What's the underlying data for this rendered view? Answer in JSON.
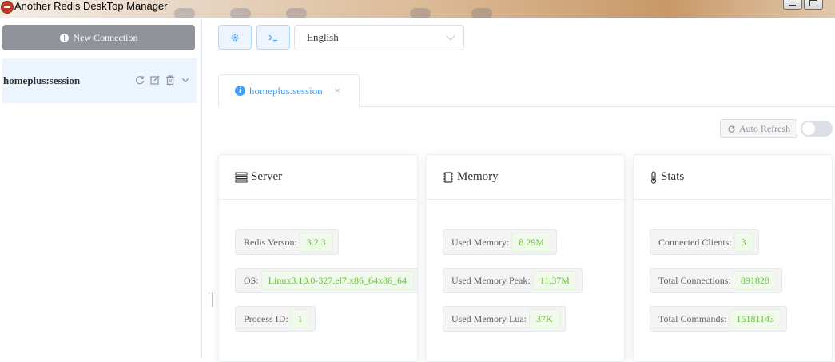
{
  "window": {
    "title": "Another Redis DeskTop Manager"
  },
  "sidebar": {
    "new_connection_label": "New Connection",
    "connections": [
      {
        "name": "homeplus:session"
      }
    ]
  },
  "toolbar": {
    "language": "English"
  },
  "tabs": [
    {
      "label": "homeplus:session",
      "close": "×"
    }
  ],
  "auto_refresh": {
    "label": "Auto Refresh",
    "enabled": false
  },
  "cards": {
    "server": {
      "title": "Server",
      "rows": [
        {
          "label": "Redis Verson:",
          "value": "3.2.3"
        },
        {
          "label": "OS:",
          "value": "Linux3.10.0-327.el7.x86_64x86_64"
        },
        {
          "label": "Process ID:",
          "value": "1"
        }
      ]
    },
    "memory": {
      "title": "Memory",
      "rows": [
        {
          "label": "Used Memory:",
          "value": "8.29M"
        },
        {
          "label": "Used Memory Peak:",
          "value": "11.37M"
        },
        {
          "label": "Used Memory Lua:",
          "value": "37K"
        }
      ]
    },
    "stats": {
      "title": "Stats",
      "rows": [
        {
          "label": "Connected Clients:",
          "value": "3"
        },
        {
          "label": "Total Connections:",
          "value": "891828"
        },
        {
          "label": "Total Commands:",
          "value": "15181143"
        }
      ]
    }
  },
  "colors": {
    "primary": "#409eff",
    "success": "#67c23a",
    "sidebar_button": "#909399"
  }
}
